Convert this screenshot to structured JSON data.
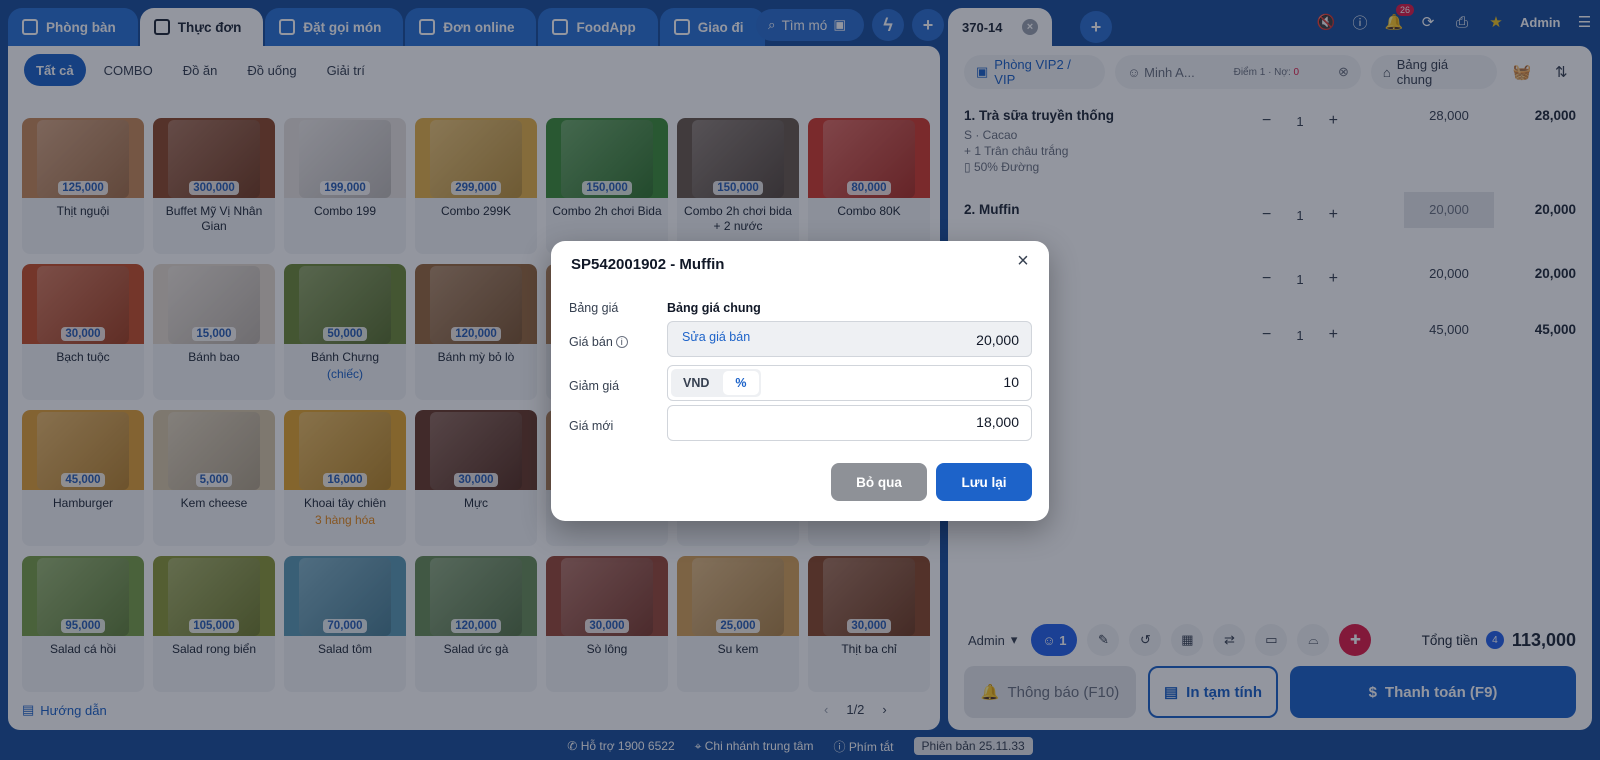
{
  "top_tabs": [
    {
      "label": "Phòng bàn",
      "icon": "table-icon"
    },
    {
      "label": "Thực đơn",
      "icon": "menu-icon"
    },
    {
      "label": "Đặt gọi món",
      "icon": "order-icon"
    },
    {
      "label": "Đơn online",
      "icon": "bag-icon"
    },
    {
      "label": "FoodApp",
      "icon": "app-icon"
    },
    {
      "label": "Giao đi",
      "icon": "delivery-icon"
    }
  ],
  "search": {
    "label": "Tìm mó"
  },
  "categories": [
    "Tất cả",
    "COMBO",
    "Đồ ăn",
    "Đồ uống",
    "Giải trí"
  ],
  "products": [
    {
      "name": "Thịt nguội",
      "price": "125,000",
      "sub": "",
      "color": "#c98a5a"
    },
    {
      "name": "Buffet Mỹ Vị Nhân Gian",
      "price": "300,000",
      "sub": "",
      "color": "#8f4a2a"
    },
    {
      "name": "Combo 199",
      "price": "199,000",
      "sub": "",
      "color": "#e9e4e0"
    },
    {
      "name": "Combo 299K",
      "price": "299,000",
      "sub": "",
      "color": "#e6b34a"
    },
    {
      "name": "Combo 2h chơi Bida",
      "price": "150,000",
      "sub": "",
      "color": "#3f8f3a"
    },
    {
      "name": "Combo 2h chơi bida + 2 nước",
      "price": "150,000",
      "sub": "",
      "color": "#6b5a4e"
    },
    {
      "name": "Combo 80K",
      "price": "80,000",
      "sub": "",
      "color": "#d23b2f"
    },
    {
      "name": "Bạch tuộc",
      "price": "30,000",
      "sub": "",
      "color": "#c6502a"
    },
    {
      "name": "Bánh bao",
      "price": "15,000",
      "sub": "",
      "color": "#e8ddd0"
    },
    {
      "name": "Bánh Chưng",
      "price": "50,000",
      "sub": "(chiếc)",
      "color": "#6f8a3a"
    },
    {
      "name": "Bánh mỳ bỏ lò",
      "price": "120,000",
      "sub": "",
      "color": "#9a6a3e"
    },
    {
      "name": "",
      "price": "",
      "sub": "",
      "color": "#b9895f"
    },
    {
      "name": "",
      "price": "",
      "sub": "",
      "color": "#b9895f"
    },
    {
      "name": "",
      "price": "",
      "sub": "",
      "color": "#b9895f"
    },
    {
      "name": "Hamburger",
      "price": "45,000",
      "sub": "",
      "color": "#e2a23a"
    },
    {
      "name": "Kem cheese",
      "price": "5,000",
      "sub": "",
      "color": "#d9c8a8"
    },
    {
      "name": "Khoai tây chiên",
      "price": "16,000",
      "sub": "3 hàng hóa",
      "color": "#e3a631"
    },
    {
      "name": "Mực",
      "price": "30,000",
      "sub": "",
      "color": "#6b3b2a"
    },
    {
      "name": "",
      "price": "",
      "sub": "",
      "color": "#b9895f"
    },
    {
      "name": "",
      "price": "",
      "sub": "",
      "color": "#b9895f"
    },
    {
      "name": "",
      "price": "",
      "sub": "",
      "color": "#b9895f"
    },
    {
      "name": "Salad cá hồi",
      "price": "95,000",
      "sub": "",
      "color": "#7aa04a"
    },
    {
      "name": "Salad rong biển",
      "price": "105,000",
      "sub": "",
      "color": "#8c9a3a"
    },
    {
      "name": "Salad tôm",
      "price": "70,000",
      "sub": "",
      "color": "#5b9bb5"
    },
    {
      "name": "Salad ức gà",
      "price": "120,000",
      "sub": "",
      "color": "#6b8f5a"
    },
    {
      "name": "Sò lông",
      "price": "30,000",
      "sub": "",
      "color": "#9a4a3a"
    },
    {
      "name": "Su kem",
      "price": "25,000",
      "sub": "",
      "color": "#d6a35a"
    },
    {
      "name": "Thịt ba chỉ",
      "price": "30,000",
      "sub": "",
      "color": "#8a4a2a"
    }
  ],
  "guide": "Hướng dẫn",
  "pager": {
    "prev": "‹",
    "current": "1/2",
    "next": "›"
  },
  "right": {
    "tab_label": "370-14",
    "user": "Admin",
    "notif_count": "26",
    "room": "Phòng VIP2 / VIP",
    "customer": "Minh A...",
    "points": "Điểm 1 · Nợ: ",
    "debt": "0",
    "pricebook": "Bảng giá chung",
    "lines": [
      {
        "name": "1. Trà sữa truyền thống",
        "subs": [
          "S · Cacao",
          "+ 1 Trân châu trắng",
          "▯ 50% Đường"
        ],
        "qty": "1",
        "price": "28,000",
        "total": "28,000"
      },
      {
        "name": "2. Muffin",
        "subs": [],
        "qty": "1",
        "price": "20,000",
        "total": "20,000"
      },
      {
        "name": "",
        "subs": [],
        "qty": "1",
        "price": "20,000",
        "total": "20,000"
      },
      {
        "name": "",
        "subs": [],
        "qty": "1",
        "price": "45,000",
        "total": "45,000"
      }
    ],
    "footer_user": "Admin",
    "guest_count": "1",
    "total_label": "Tổng tiền",
    "total_items": "4",
    "total_value": "113,000",
    "notify_btn": "Thông báo (F10)",
    "print_btn": "In tạm tính",
    "pay_btn": "Thanh toán (F9)"
  },
  "status_bar": {
    "support": "Hỗ trợ 1900 6522",
    "branch": "Chi nhánh trung tâm",
    "shortcuts": "Phím tắt",
    "version": "Phiên bản 25.11.33"
  },
  "modal": {
    "title": "SP542001902 - Muffin",
    "pricebook_label": "Bảng giá",
    "pricebook_value": "Bảng giá chung",
    "price_label": "Giá bán",
    "edit_price_link": "Sửa giá bán",
    "price_value": "20,000",
    "discount_label": "Giảm giá",
    "discount_units": [
      "VND",
      "%"
    ],
    "discount_value": "10",
    "new_price_label": "Giá mới",
    "new_price_value": "18,000",
    "cancel": "Bỏ qua",
    "save": "Lưu lại"
  }
}
